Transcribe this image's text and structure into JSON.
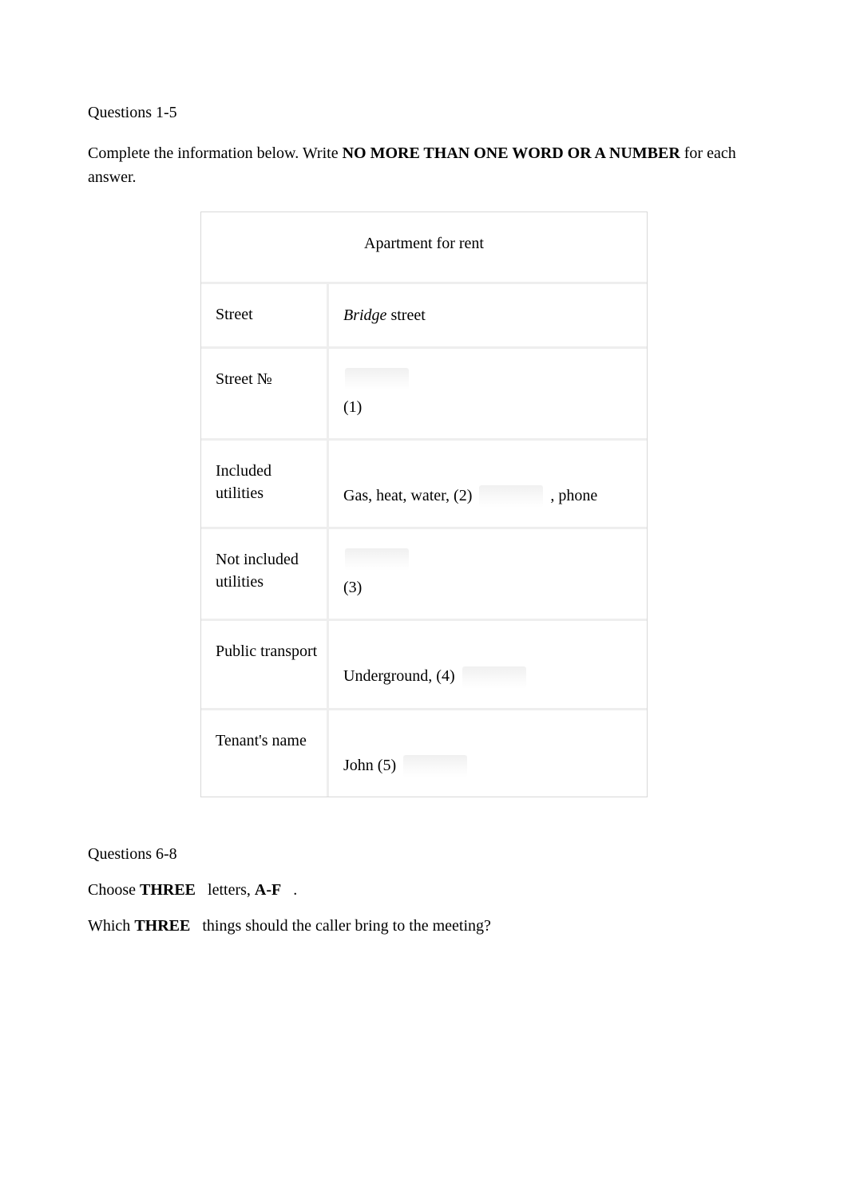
{
  "q15": {
    "heading": "Questions 1-5",
    "instruction_part1": "Complete the information below. Write ",
    "instruction_bold": "NO MORE THAN ONE WORD OR A NUMBER",
    "instruction_part2": " for each answer."
  },
  "table": {
    "title": "Apartment for rent",
    "rows": [
      {
        "label": "Street",
        "prefix": "",
        "italic_text": "Bridge",
        "suffix": " street",
        "number": "",
        "has_blank_above": false,
        "has_inline_blank": false,
        "trailing": ""
      },
      {
        "label": "Street №",
        "prefix": "",
        "italic_text": "",
        "suffix": "",
        "number": "(1)",
        "has_blank_above": true,
        "has_inline_blank": false,
        "trailing": ""
      },
      {
        "label": "Included utilities",
        "prefix": "Gas, heat, water,   ",
        "italic_text": "",
        "suffix": "",
        "number": "(2)",
        "has_blank_above": false,
        "has_inline_blank": true,
        "trailing": " , phone"
      },
      {
        "label": "Not included utilities",
        "prefix": "",
        "italic_text": "",
        "suffix": "",
        "number": "(3)",
        "has_blank_above": true,
        "has_inline_blank": false,
        "trailing": ""
      },
      {
        "label": "Public transport",
        "prefix": "Underground,   ",
        "italic_text": "",
        "suffix": "",
        "number": "(4)",
        "has_blank_above": false,
        "has_inline_blank": true,
        "trailing": ""
      },
      {
        "label": "Tenant's name",
        "prefix": "John  ",
        "italic_text": "",
        "suffix": "",
        "number": "(5)",
        "has_blank_above": false,
        "has_inline_blank": true,
        "trailing": ""
      }
    ]
  },
  "q68": {
    "heading": "Questions 6-8",
    "line1_part1": "Choose ",
    "line1_bold1": "THREE",
    "line1_part2": " letters, ",
    "line1_bold2": "A-F",
    "line1_part3": ".",
    "line2_part1": "Which ",
    "line2_bold": "THREE",
    "line2_part2": " things should the caller bring to the meeting?"
  }
}
